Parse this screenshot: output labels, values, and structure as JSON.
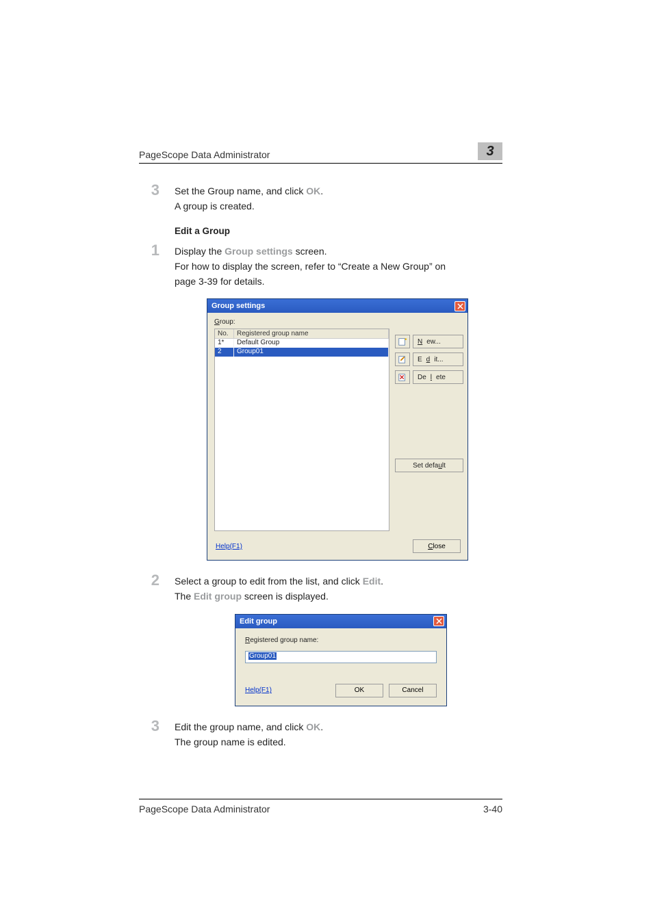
{
  "header": {
    "title": "PageScope Data Administrator",
    "chapter": "3"
  },
  "steps_top": {
    "num": "3",
    "line1_pre": "Set the Group name, and click ",
    "line1_bold": "OK",
    "line1_post": ".",
    "line2": "A group is created."
  },
  "subheading": "Edit a Group",
  "step1": {
    "num": "1",
    "line1_pre": "Display the ",
    "line1_bold": "Group settings",
    "line1_post": " screen.",
    "line2": "For how to display the screen, refer to “Create a New Group” on page 3-39 for details."
  },
  "dialog1": {
    "title": "Group settings",
    "group_label": "Group:",
    "columns": {
      "no": "No.",
      "name": "Registered group name"
    },
    "rows": [
      {
        "no": "1*",
        "name": "Default Group",
        "selected": false
      },
      {
        "no": "2",
        "name": "Group01",
        "selected": true
      }
    ],
    "buttons": {
      "new": "New...",
      "edit": "Edit...",
      "delete": "Delete",
      "set_default": "Set default",
      "close": "Close"
    },
    "help": "Help(F1)"
  },
  "step2": {
    "num": "2",
    "line1_pre": "Select a group to edit from the list, and click ",
    "line1_bold": "Edit",
    "line1_post": ".",
    "line2_pre": "The ",
    "line2_bold": "Edit group",
    "line2_post": " screen is displayed."
  },
  "dialog2": {
    "title": "Edit group",
    "label": "Registered group name:",
    "value": "Group01",
    "help": "Help(F1)",
    "ok": "OK",
    "cancel": "Cancel"
  },
  "step3": {
    "num": "3",
    "line1_pre": "Edit the group name, and click ",
    "line1_bold": "OK",
    "line1_post": ".",
    "line2": "The group name is edited."
  },
  "footer": {
    "left": "PageScope Data Administrator",
    "right": "3-40"
  },
  "icons": {
    "close": "close-icon",
    "new": "new-icon",
    "edit": "edit-icon",
    "delete": "delete-icon"
  }
}
